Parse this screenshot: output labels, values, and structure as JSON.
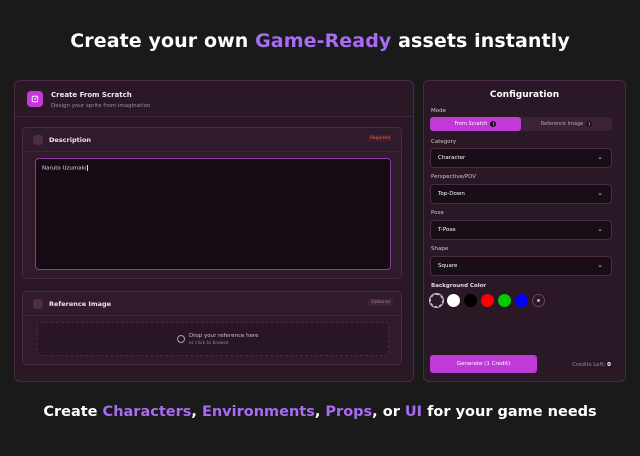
{
  "colors": {
    "accent": "#a86bf3",
    "primary_button": "#c03ad8",
    "panel_bg": "#2a1826",
    "page_bg": "#1a1a1a"
  },
  "headline": {
    "prefix": "Create your own ",
    "highlight": "Game-Ready",
    "suffix": " assets instantly"
  },
  "footline": {
    "t1": "Create ",
    "h1": "Characters",
    "t2": ", ",
    "h2": "Environments",
    "t3": ", ",
    "h3": "Props",
    "t4": ", or ",
    "h4": "UI",
    "t5": " for your game needs"
  },
  "left_panel": {
    "header": {
      "icon": "edit-icon",
      "title": "Create From Scratch",
      "subtitle": "Design your sprite from imagination"
    },
    "description": {
      "icon": "document-icon",
      "title": "Description",
      "badge": "Required",
      "value": "Naruto Uzumaki"
    },
    "reference": {
      "icon": "image-icon",
      "title": "Reference Image",
      "badge": "Optional",
      "drop_main": "Drop your reference here",
      "drop_sub": "or click to browse",
      "drop_icon": "upload-icon"
    }
  },
  "config": {
    "title": "Configuration",
    "mode": {
      "label": "Mode",
      "options": [
        "From Scratch",
        "Reference Image"
      ],
      "selected": "From Scratch"
    },
    "category": {
      "label": "Category",
      "value": "Character"
    },
    "perspective": {
      "label": "Perspective/POV",
      "value": "Top-Down"
    },
    "pose": {
      "label": "Pose",
      "value": "T-Pose"
    },
    "shape": {
      "label": "Shape",
      "value": "Square"
    },
    "background": {
      "label": "Background Color",
      "swatches": [
        "transparent",
        "#ffffff",
        "#000000",
        "#ff0000",
        "#00cc00",
        "#0000ff"
      ],
      "selected": "transparent",
      "add_icon": "color-picker-icon"
    },
    "generate_label": "Generate (1 Credit)",
    "credits_label": "Credits Left:",
    "credits_value": "0"
  }
}
